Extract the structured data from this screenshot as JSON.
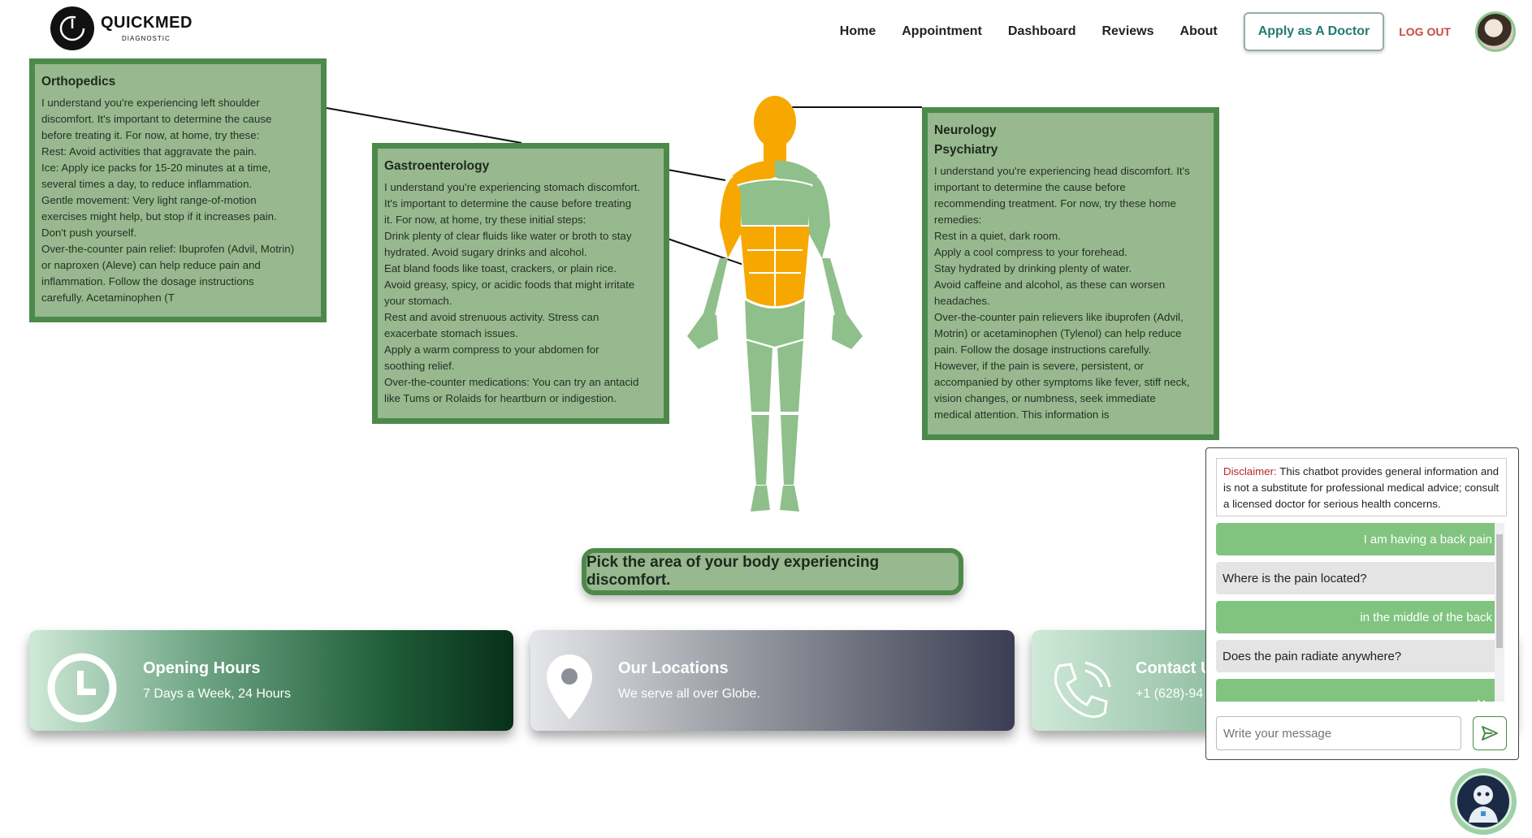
{
  "header": {
    "logo_main": "QUICKMED",
    "logo_sub": "DIAGNOSTIC",
    "nav": [
      "Home",
      "Appointment",
      "Dashboard",
      "Reviews",
      "About"
    ],
    "apply_label": "Apply as A Doctor",
    "logout_label": "LOG OUT"
  },
  "boxes": {
    "orthopedics": {
      "title": "Orthopedics",
      "lines": [
        "I understand you're experiencing left shoulder",
        "discomfort. It's important to determine the cause",
        "before treating it. For now, at home, try these:",
        "Rest: Avoid activities that aggravate the pain.",
        "Ice: Apply ice packs for 15-20 minutes at a time,",
        "several times a day, to reduce inflammation.",
        "Gentle movement: Very light range-of-motion",
        "exercises might help, but stop if it increases pain.",
        "Don't push yourself.",
        "Over-the-counter pain relief: Ibuprofen (Advil, Motrin)",
        "or naproxen (Aleve) can help reduce pain and",
        "inflammation. Follow the dosage instructions",
        "carefully. Acetaminophen (T"
      ]
    },
    "gastro": {
      "title": "Gastroenterology",
      "lines": [
        "I understand you're experiencing stomach discomfort.",
        "It's important to determine the cause before treating",
        "it. For now, at home, try these initial steps:",
        "Drink plenty of clear fluids like water or broth to stay",
        "hydrated. Avoid sugary drinks and alcohol.",
        "Eat bland foods like toast, crackers, or plain rice.",
        "Avoid greasy, spicy, or acidic foods that might irritate",
        "your stomach.",
        "Rest and avoid strenuous activity. Stress can",
        "exacerbate stomach issues.",
        "Apply a warm compress to your abdomen for",
        "soothing relief.",
        "Over-the-counter medications: You can try an antacid",
        "like Tums or Rolaids for heartburn or indigestion."
      ]
    },
    "neuro": {
      "title": "Neurology",
      "title2": "Psychiatry",
      "lines": [
        "I understand you're experiencing head discomfort. It's",
        "important to determine the cause before",
        "recommending treatment. For now, try these home",
        "remedies:",
        "Rest in a quiet, dark room.",
        "Apply a cool compress to your forehead.",
        "Stay hydrated by drinking plenty of water.",
        "Avoid caffeine and alcohol, as these can worsen",
        "headaches.",
        "Over-the-counter pain relievers like ibuprofen (Advil,",
        "Motrin) or acetaminophen (Tylenol) can help reduce",
        "pain. Follow the dosage instructions carefully.",
        "However, if the pain is severe, persistent, or",
        "accompanied by other symptoms like fever, stiff neck,",
        "vision changes, or numbness, seek immediate",
        "medical attention. This information is"
      ]
    }
  },
  "prompt": "Pick the area of your body experiencing discomfort.",
  "cards": {
    "hours": {
      "title": "Opening Hours",
      "text": "7 Days a Week, 24 Hours"
    },
    "locations": {
      "title": "Our Locations",
      "text": "We serve all over Globe."
    },
    "contact": {
      "title": "Contact U",
      "text": "+1 (628)-94"
    }
  },
  "chat": {
    "disclaimer_label": "Disclaimer:",
    "disclaimer_text": " This chatbot provides general information and is not a substitute for professional medical advice; consult a licensed doctor for serious health concerns.",
    "messages": [
      {
        "from": "user",
        "text": "I am having a back pain"
      },
      {
        "from": "bot",
        "text": "Where is the pain located?"
      },
      {
        "from": "user",
        "text": "in the middle of the back"
      },
      {
        "from": "bot",
        "text": "Does the pain radiate anywhere?"
      },
      {
        "from": "user",
        "text": "No"
      }
    ],
    "input_placeholder": "Write your message"
  },
  "colors": {
    "box_bg": "#98b88f",
    "box_border": "#4c8a4c",
    "highlight": "#f7a800",
    "body": "#8fbf8a",
    "accent_teal": "#237a72",
    "logout_red": "#c74a44"
  },
  "icons": [
    "clock-icon",
    "location-pin-icon",
    "phone-icon",
    "send-icon",
    "chatbot-avatar-icon"
  ]
}
